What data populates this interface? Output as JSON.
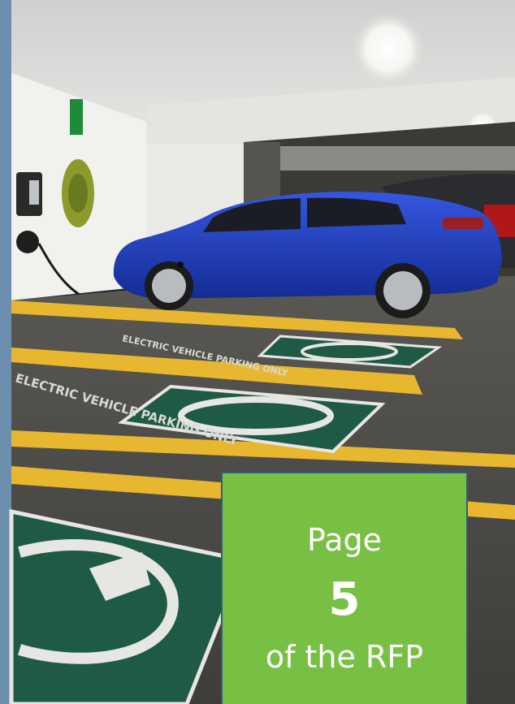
{
  "callout": {
    "line1": "Page",
    "page_number": "5",
    "line3": "of the RFP",
    "background_color": "#77c043",
    "border_color": "#2d5f7a"
  },
  "scene": {
    "car_color": "#1f3fc2",
    "parking_stall_color": "#1f5a47",
    "line_paint_color": "#e8b730",
    "floor_color": "#4d4b47",
    "stencil_text_back": "ELECTRIC VEHICLE PARKING ONLY",
    "stencil_text_front": "ELECTRIC VEHICLE PARKING ONLY"
  }
}
